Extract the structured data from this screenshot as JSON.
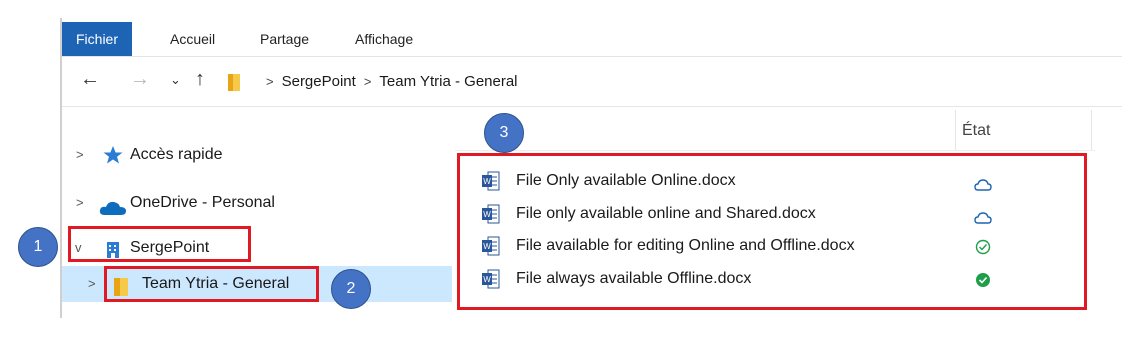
{
  "ribbon": {
    "tabs": [
      {
        "label": "Fichier",
        "active": true
      },
      {
        "label": "Accueil"
      },
      {
        "label": "Partage"
      },
      {
        "label": "Affichage"
      }
    ]
  },
  "address": {
    "back_icon": "arrow-left-icon",
    "forward_icon": "arrow-right-icon",
    "recent_icon": "chevron-down-icon",
    "up_icon": "arrow-up-icon",
    "breadcrumb": [
      "SergePoint",
      "Team Ytria - General"
    ]
  },
  "nav": {
    "items": [
      {
        "label": "Accès rapide",
        "icon": "star-icon"
      },
      {
        "label": "OneDrive - Personal",
        "icon": "cloud-icon"
      },
      {
        "label": "SergePoint",
        "icon": "building-icon",
        "expanded": true
      },
      {
        "label": "Team Ytria - General",
        "icon": "folder-icon",
        "selected": true
      }
    ]
  },
  "columns": {
    "status_header": "État"
  },
  "files": [
    {
      "name": "File Only available Online.docx",
      "status": "cloud-outline-icon"
    },
    {
      "name": "File only available online and Shared.docx",
      "status": "cloud-outline-icon"
    },
    {
      "name": "File available  for editing Online and Offline.docx",
      "status": "check-circle-outline-icon"
    },
    {
      "name": "File always available Offline.docx",
      "status": "check-circle-filled-icon"
    }
  ],
  "annotations": {
    "badge1": "1",
    "badge2": "2",
    "badge3": "3"
  },
  "colors": {
    "accent": "#1e64b4",
    "annotation_red": "#e01a22",
    "badge_blue": "#4472c4",
    "selected_bg": "#cce8ff",
    "status_green": "#1f9e4a",
    "cloud_blue": "#1e64b4"
  }
}
